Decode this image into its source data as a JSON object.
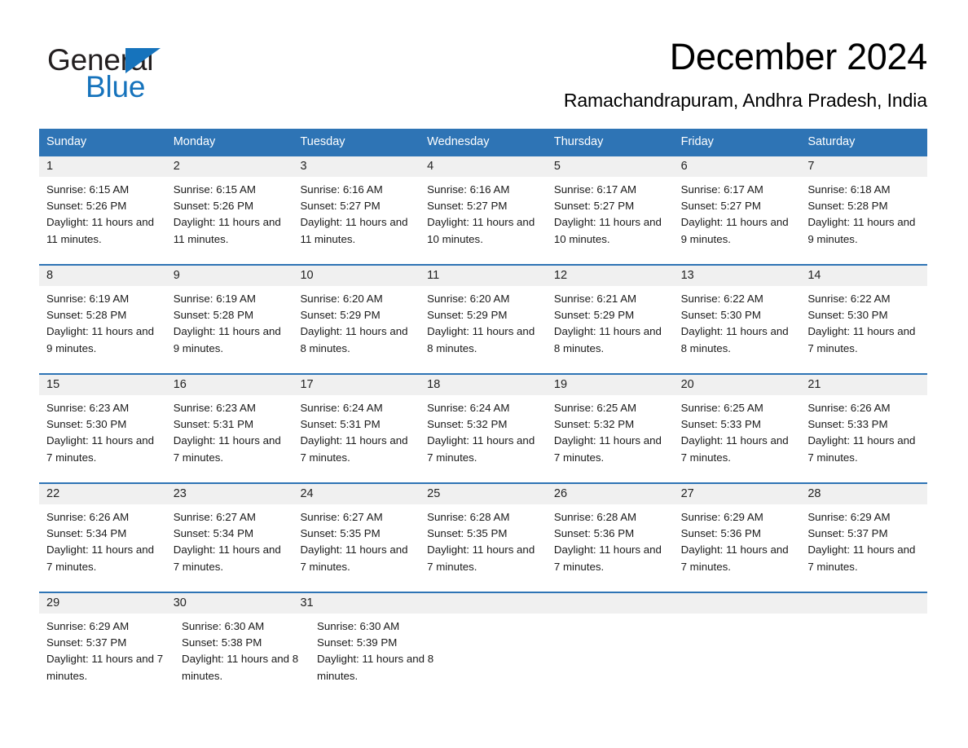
{
  "logo": {
    "word1": "General",
    "word2": "Blue",
    "triangle_color": "#1673bc",
    "text_color": "#231f20"
  },
  "header": {
    "month_title": "December 2024",
    "location": "Ramachandrapuram, Andhra Pradesh, India"
  },
  "theme": {
    "header_blue": "#2e74b5",
    "daynum_band": "#f0f0f0",
    "text": "#1a1a1a"
  },
  "weekdays": [
    "Sunday",
    "Monday",
    "Tuesday",
    "Wednesday",
    "Thursday",
    "Friday",
    "Saturday"
  ],
  "weeks": [
    {
      "days": [
        {
          "num": "1",
          "detail": "Sunrise: 6:15 AM\nSunset: 5:26 PM\nDaylight: 11 hours and 11 minutes."
        },
        {
          "num": "2",
          "detail": "Sunrise: 6:15 AM\nSunset: 5:26 PM\nDaylight: 11 hours and 11 minutes."
        },
        {
          "num": "3",
          "detail": "Sunrise: 6:16 AM\nSunset: 5:27 PM\nDaylight: 11 hours and 11 minutes."
        },
        {
          "num": "4",
          "detail": "Sunrise: 6:16 AM\nSunset: 5:27 PM\nDaylight: 11 hours and 10 minutes."
        },
        {
          "num": "5",
          "detail": "Sunrise: 6:17 AM\nSunset: 5:27 PM\nDaylight: 11 hours and 10 minutes."
        },
        {
          "num": "6",
          "detail": "Sunrise: 6:17 AM\nSunset: 5:27 PM\nDaylight: 11 hours and 9 minutes."
        },
        {
          "num": "7",
          "detail": "Sunrise: 6:18 AM\nSunset: 5:28 PM\nDaylight: 11 hours and 9 minutes."
        }
      ]
    },
    {
      "days": [
        {
          "num": "8",
          "detail": "Sunrise: 6:19 AM\nSunset: 5:28 PM\nDaylight: 11 hours and 9 minutes."
        },
        {
          "num": "9",
          "detail": "Sunrise: 6:19 AM\nSunset: 5:28 PM\nDaylight: 11 hours and 9 minutes."
        },
        {
          "num": "10",
          "detail": "Sunrise: 6:20 AM\nSunset: 5:29 PM\nDaylight: 11 hours and 8 minutes."
        },
        {
          "num": "11",
          "detail": "Sunrise: 6:20 AM\nSunset: 5:29 PM\nDaylight: 11 hours and 8 minutes."
        },
        {
          "num": "12",
          "detail": "Sunrise: 6:21 AM\nSunset: 5:29 PM\nDaylight: 11 hours and 8 minutes."
        },
        {
          "num": "13",
          "detail": "Sunrise: 6:22 AM\nSunset: 5:30 PM\nDaylight: 11 hours and 8 minutes."
        },
        {
          "num": "14",
          "detail": "Sunrise: 6:22 AM\nSunset: 5:30 PM\nDaylight: 11 hours and 7 minutes."
        }
      ]
    },
    {
      "days": [
        {
          "num": "15",
          "detail": "Sunrise: 6:23 AM\nSunset: 5:30 PM\nDaylight: 11 hours and 7 minutes."
        },
        {
          "num": "16",
          "detail": "Sunrise: 6:23 AM\nSunset: 5:31 PM\nDaylight: 11 hours and 7 minutes."
        },
        {
          "num": "17",
          "detail": "Sunrise: 6:24 AM\nSunset: 5:31 PM\nDaylight: 11 hours and 7 minutes."
        },
        {
          "num": "18",
          "detail": "Sunrise: 6:24 AM\nSunset: 5:32 PM\nDaylight: 11 hours and 7 minutes."
        },
        {
          "num": "19",
          "detail": "Sunrise: 6:25 AM\nSunset: 5:32 PM\nDaylight: 11 hours and 7 minutes."
        },
        {
          "num": "20",
          "detail": "Sunrise: 6:25 AM\nSunset: 5:33 PM\nDaylight: 11 hours and 7 minutes."
        },
        {
          "num": "21",
          "detail": "Sunrise: 6:26 AM\nSunset: 5:33 PM\nDaylight: 11 hours and 7 minutes."
        }
      ]
    },
    {
      "days": [
        {
          "num": "22",
          "detail": "Sunrise: 6:26 AM\nSunset: 5:34 PM\nDaylight: 11 hours and 7 minutes."
        },
        {
          "num": "23",
          "detail": "Sunrise: 6:27 AM\nSunset: 5:34 PM\nDaylight: 11 hours and 7 minutes."
        },
        {
          "num": "24",
          "detail": "Sunrise: 6:27 AM\nSunset: 5:35 PM\nDaylight: 11 hours and 7 minutes."
        },
        {
          "num": "25",
          "detail": "Sunrise: 6:28 AM\nSunset: 5:35 PM\nDaylight: 11 hours and 7 minutes."
        },
        {
          "num": "26",
          "detail": "Sunrise: 6:28 AM\nSunset: 5:36 PM\nDaylight: 11 hours and 7 minutes."
        },
        {
          "num": "27",
          "detail": "Sunrise: 6:29 AM\nSunset: 5:36 PM\nDaylight: 11 hours and 7 minutes."
        },
        {
          "num": "28",
          "detail": "Sunrise: 6:29 AM\nSunset: 5:37 PM\nDaylight: 11 hours and 7 minutes."
        }
      ]
    },
    {
      "days": [
        {
          "num": "29",
          "detail": "Sunrise: 6:29 AM\nSunset: 5:37 PM\nDaylight: 11 hours and 7 minutes."
        },
        {
          "num": "30",
          "detail": "Sunrise: 6:30 AM\nSunset: 5:38 PM\nDaylight: 11 hours and 8 minutes."
        },
        {
          "num": "31",
          "detail": "Sunrise: 6:30 AM\nSunset: 5:39 PM\nDaylight: 11 hours and 8 minutes."
        },
        {
          "num": "",
          "detail": ""
        },
        {
          "num": "",
          "detail": ""
        },
        {
          "num": "",
          "detail": ""
        },
        {
          "num": "",
          "detail": ""
        }
      ]
    }
  ]
}
